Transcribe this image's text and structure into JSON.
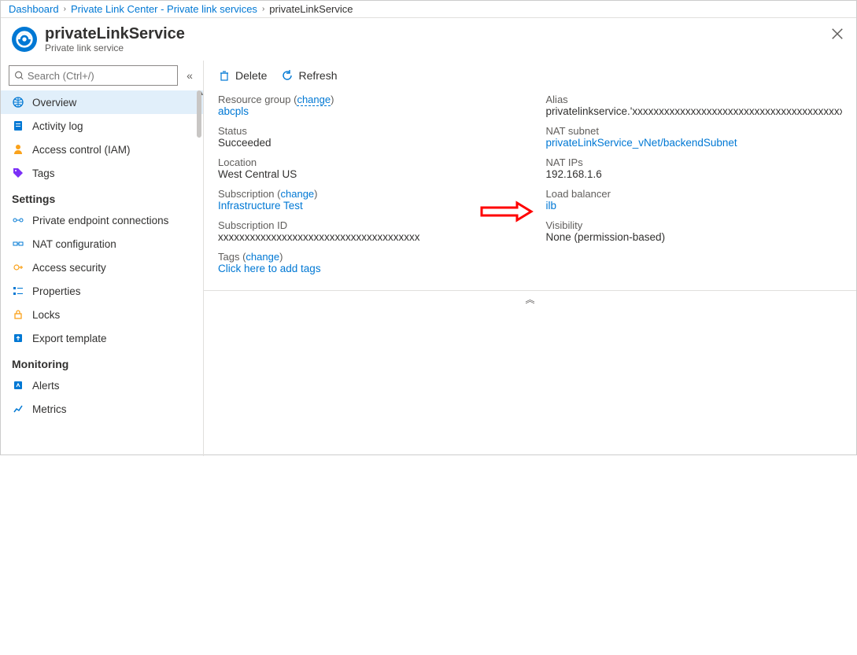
{
  "breadcrumb": {
    "items": [
      "Dashboard",
      "Private Link Center - Private link services",
      "privateLinkService"
    ]
  },
  "header": {
    "title": "privateLinkService",
    "subtitle": "Private link service"
  },
  "search": {
    "placeholder": "Search (Ctrl+/)"
  },
  "sidebar": {
    "items": [
      {
        "label": "Overview",
        "icon": "globe",
        "selected": true
      },
      {
        "label": "Activity log",
        "icon": "log",
        "selected": false
      },
      {
        "label": "Access control (IAM)",
        "icon": "person",
        "selected": false
      },
      {
        "label": "Tags",
        "icon": "tag",
        "selected": false
      }
    ],
    "settings_header": "Settings",
    "settings": [
      {
        "label": "Private endpoint connections",
        "icon": "endpoint"
      },
      {
        "label": "NAT configuration",
        "icon": "nat"
      },
      {
        "label": "Access security",
        "icon": "access"
      },
      {
        "label": "Properties",
        "icon": "props"
      },
      {
        "label": "Locks",
        "icon": "lock"
      },
      {
        "label": "Export template",
        "icon": "export"
      }
    ],
    "monitoring_header": "Monitoring",
    "monitoring": [
      {
        "label": "Alerts",
        "icon": "alerts"
      },
      {
        "label": "Metrics",
        "icon": "metrics"
      }
    ]
  },
  "toolbar": {
    "delete_label": "Delete",
    "refresh_label": "Refresh"
  },
  "props": {
    "left": {
      "resource_group_label": "Resource group",
      "resource_group_change": "change",
      "resource_group_value": "abcpls",
      "status_label": "Status",
      "status_value": "Succeeded",
      "location_label": "Location",
      "location_value": "West Central US",
      "subscription_label": "Subscription",
      "subscription_change": "change",
      "subscription_value": "Infrastructure Test",
      "subscription_id_label": "Subscription ID",
      "subscription_id_value": "xxxxxxxxxxxxxxxxxxxxxxxxxxxxxxxxxxxxxx",
      "tags_label": "Tags",
      "tags_change": "change",
      "tags_value": "Click here to add tags"
    },
    "right": {
      "alias_label": "Alias",
      "alias_value": "privatelinkservice.'xxxxxxxxxxxxxxxxxxxxxxxxxxxxxxxxxxxxxxxxxxx",
      "nat_subnet_label": "NAT subnet",
      "nat_subnet_value": "privateLinkService_vNet/backendSubnet",
      "nat_ips_label": "NAT IPs",
      "nat_ips_value": "192.168.1.6",
      "load_balancer_label": "Load balancer",
      "load_balancer_value": "ilb",
      "visibility_label": "Visibility",
      "visibility_value": "None (permission-based)"
    }
  }
}
